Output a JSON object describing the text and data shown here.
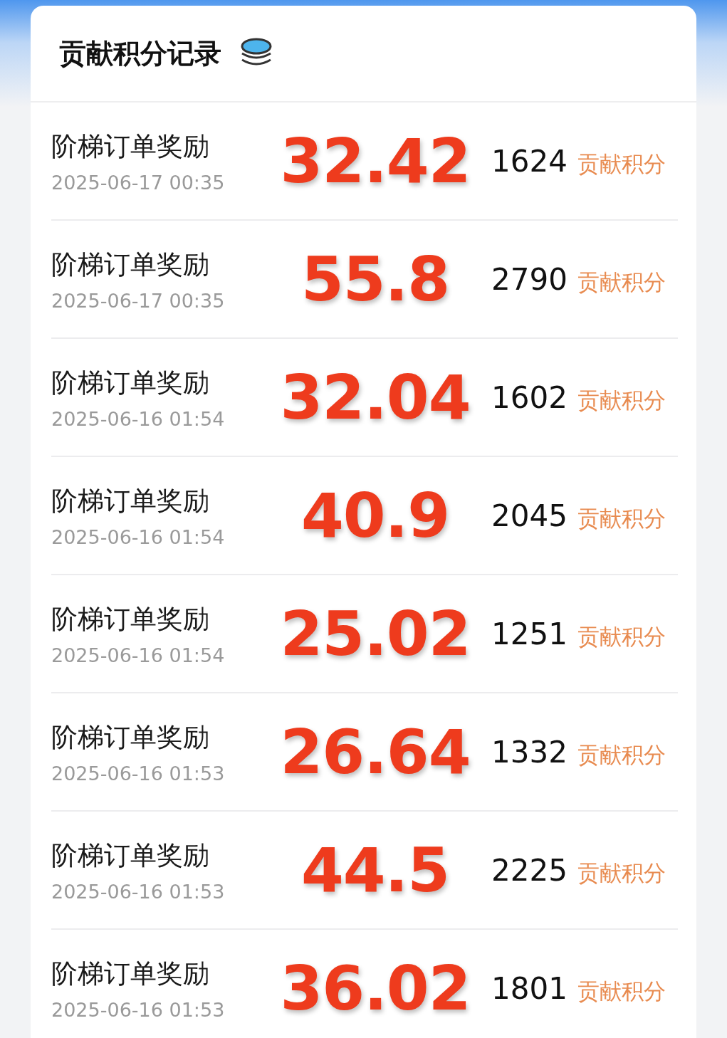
{
  "header": {
    "title": "贡献积分记录"
  },
  "records": [
    {
      "title": "阶梯订单奖励",
      "time": "2025-06-17 00:35",
      "amount": "32.42",
      "points": "1624",
      "unit": "贡献积分"
    },
    {
      "title": "阶梯订单奖励",
      "time": "2025-06-17 00:35",
      "amount": "55.8",
      "points": "2790",
      "unit": "贡献积分"
    },
    {
      "title": "阶梯订单奖励",
      "time": "2025-06-16 01:54",
      "amount": "32.04",
      "points": "1602",
      "unit": "贡献积分"
    },
    {
      "title": "阶梯订单奖励",
      "time": "2025-06-16 01:54",
      "amount": "40.9",
      "points": "2045",
      "unit": "贡献积分"
    },
    {
      "title": "阶梯订单奖励",
      "time": "2025-06-16 01:54",
      "amount": "25.02",
      "points": "1251",
      "unit": "贡献积分"
    },
    {
      "title": "阶梯订单奖励",
      "time": "2025-06-16 01:53",
      "amount": "26.64",
      "points": "1332",
      "unit": "贡献积分"
    },
    {
      "title": "阶梯订单奖励",
      "time": "2025-06-16 01:53",
      "amount": "44.5",
      "points": "2225",
      "unit": "贡献积分"
    },
    {
      "title": "阶梯订单奖励",
      "time": "2025-06-16 01:53",
      "amount": "36.02",
      "points": "1801",
      "unit": "贡献积分"
    }
  ]
}
